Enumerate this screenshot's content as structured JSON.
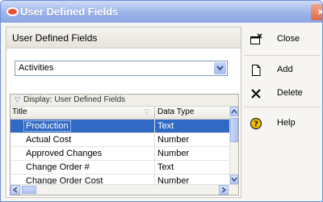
{
  "window": {
    "title": "User Defined Fields"
  },
  "panel": {
    "title": "User Defined Fields"
  },
  "subject_area": {
    "selected": "Activities"
  },
  "grid": {
    "group_label": "Display: User Defined Fields",
    "columns": [
      "Title",
      "Data Type"
    ],
    "rows": [
      {
        "title": "Production",
        "data_type": "Text",
        "selected": true
      },
      {
        "title": "Actual Cost",
        "data_type": "Number"
      },
      {
        "title": "Approved Changes",
        "data_type": "Number"
      },
      {
        "title": "Change Order #",
        "data_type": "Text"
      },
      {
        "title": "Change Order Cost",
        "data_type": "Number"
      }
    ]
  },
  "actions": {
    "close_label": "Close",
    "add_label": "Add",
    "delete_label": "Delete",
    "help_label": "Help"
  },
  "icons": {
    "close": "close-window-icon",
    "add": "new-document-icon",
    "delete": "x-delete-icon",
    "help": "question-help-icon"
  },
  "colors": {
    "selection": "#316ac5",
    "titlebar": "#9db4e8",
    "help_icon": "#f3c000"
  }
}
